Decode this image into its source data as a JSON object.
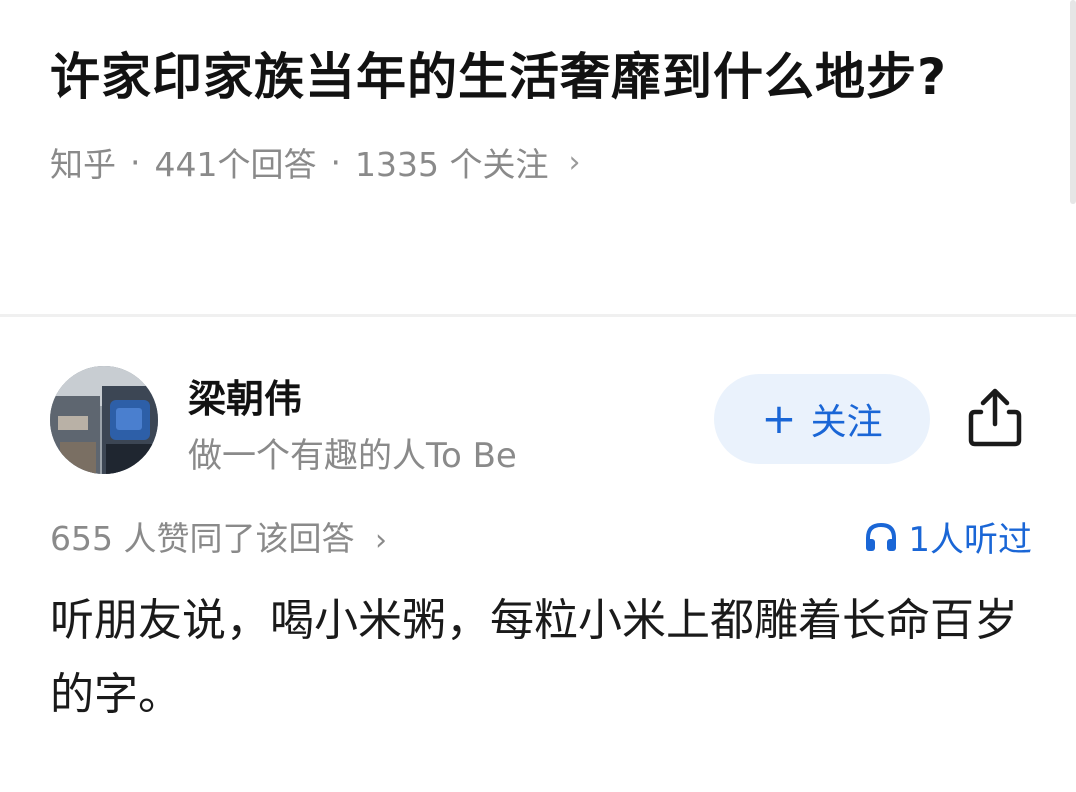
{
  "question": {
    "title": "许家印家族当年的生活奢靡到什么地步?",
    "source": "知乎",
    "separator": "·",
    "answer_count": "441个回答",
    "follower_count": "1335 个关注",
    "chevron": "›"
  },
  "author": {
    "name": "梁朝伟",
    "bio": "做一个有趣的人To Be",
    "follow_label": "关注",
    "follow_plus": "+"
  },
  "stats": {
    "upvote_text": "655 人赞同了该回答",
    "chevron": "›",
    "listen_text": "1人听过"
  },
  "answer": {
    "body": "听朋友说，喝小米粥，每粒小米上都雕着长命百岁的字。"
  },
  "colors": {
    "accent": "#1a66d6",
    "follow_bg": "#eaf2fc",
    "meta_gray": "#8a8a8a"
  },
  "icons": {
    "share": "share-icon",
    "headphones": "headphones-icon",
    "avatar": "avatar"
  }
}
